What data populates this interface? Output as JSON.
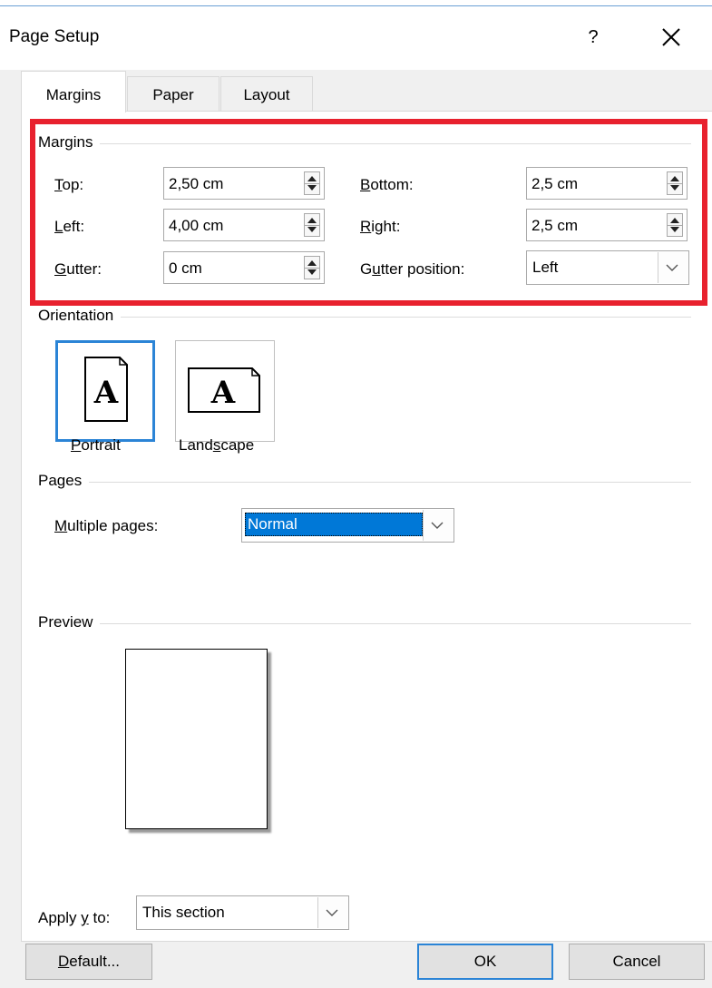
{
  "window": {
    "title": "Page Setup",
    "help_label": "?",
    "close_icon": "close-icon"
  },
  "tabs": [
    {
      "label": "Margins",
      "active": true
    },
    {
      "label": "Paper",
      "active": false
    },
    {
      "label": "Layout",
      "active": false
    }
  ],
  "margins": {
    "group_label": "Margins",
    "top": {
      "label_pre": "",
      "label_u": "T",
      "label_post": "op:",
      "value": "2,50 cm"
    },
    "left": {
      "label_pre": "",
      "label_u": "L",
      "label_post": "eft:",
      "value": "4,00 cm"
    },
    "gutter": {
      "label_pre": "",
      "label_u": "G",
      "label_post": "utter:",
      "value": "0 cm"
    },
    "bottom": {
      "label_pre": "",
      "label_u": "B",
      "label_post": "ottom:",
      "value": "2,5 cm"
    },
    "right": {
      "label_pre": "",
      "label_u": "R",
      "label_post": "ight:",
      "value": "2,5 cm"
    },
    "gutter_position": {
      "label_pre": "G",
      "label_u": "u",
      "label_post": "tter position:",
      "value": "Left"
    }
  },
  "orientation": {
    "group_label": "Orientation",
    "portrait": {
      "label_pre": "",
      "label_u": "P",
      "label_post": "ortrait",
      "selected": true,
      "glyph": "A"
    },
    "landscape": {
      "label_pre": "Land",
      "label_u": "s",
      "label_post": "cape",
      "selected": false,
      "glyph": "A"
    }
  },
  "pages": {
    "group_label": "Pages",
    "multiple_pages": {
      "label_pre": "",
      "label_u": "M",
      "label_post": "ultiple pages:",
      "value": "Normal"
    }
  },
  "preview": {
    "group_label": "Preview"
  },
  "apply_to": {
    "label_pre": "Apply ",
    "label_u": "y",
    "label_post": " to:",
    "value": "This section"
  },
  "buttons": {
    "default": {
      "label_pre": "",
      "label_u": "D",
      "label_post": "efault..."
    },
    "ok": "OK",
    "cancel": "Cancel"
  },
  "colors": {
    "highlight_box": "#e8212e",
    "selection_blue": "#2b84d6",
    "selected_text_bg": "#0078d7"
  }
}
